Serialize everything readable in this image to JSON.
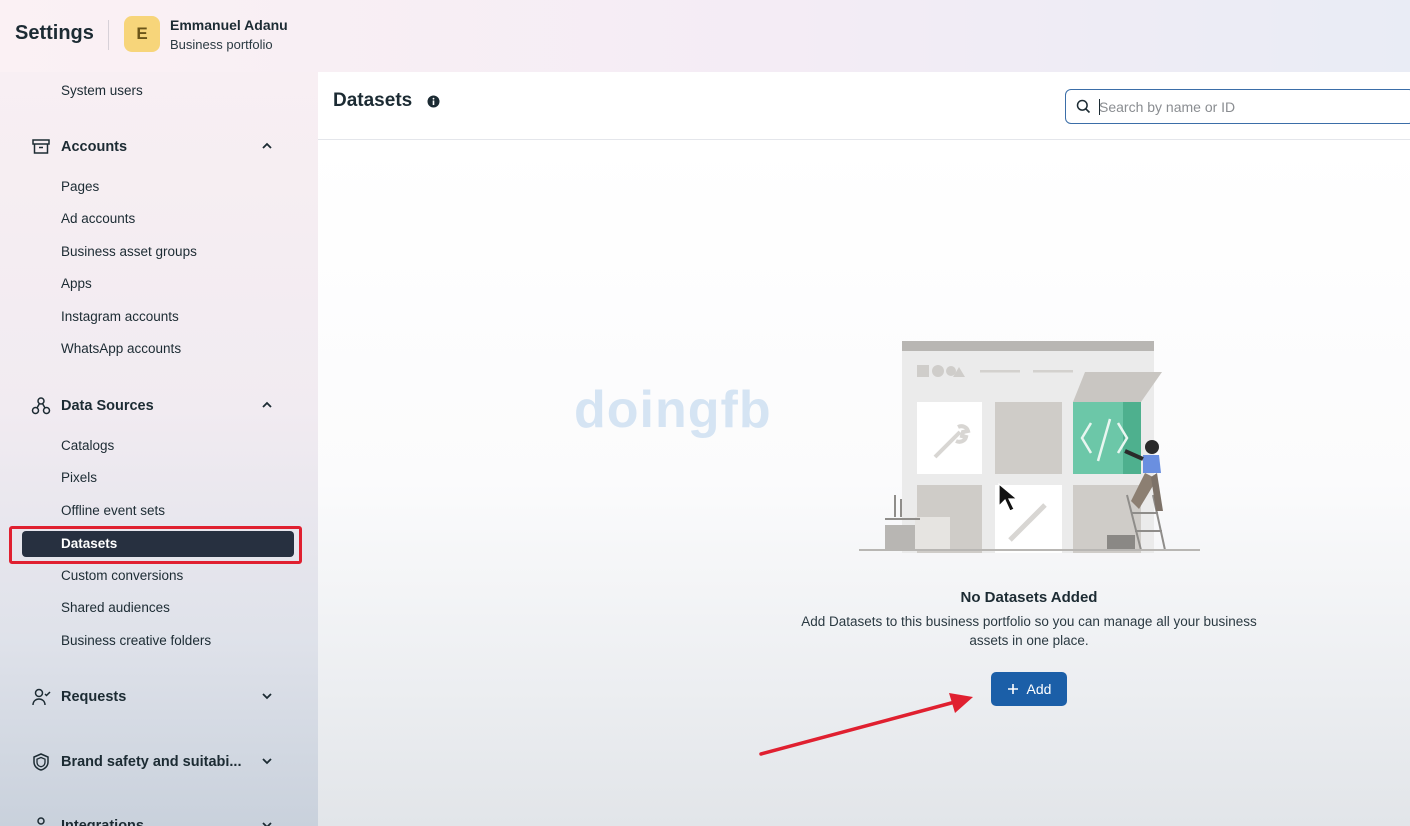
{
  "header": {
    "settings_title": "Settings",
    "avatar_letter": "E",
    "portfolio_name": "Emmanuel Adanu",
    "portfolio_type": "Business portfolio"
  },
  "sidebar": {
    "top_item": "System users",
    "accounts": {
      "label": "Accounts",
      "items": [
        "Pages",
        "Ad accounts",
        "Business asset groups",
        "Apps",
        "Instagram accounts",
        "WhatsApp accounts"
      ]
    },
    "data_sources": {
      "label": "Data Sources",
      "items": [
        "Catalogs",
        "Pixels",
        "Offline event sets",
        "Datasets",
        "Custom conversions",
        "Shared audiences",
        "Business creative folders"
      ]
    },
    "requests": {
      "label": "Requests"
    },
    "brand_safety": {
      "label": "Brand safety and suitabi..."
    },
    "integrations": {
      "label": "Integrations"
    }
  },
  "main": {
    "page_title": "Datasets",
    "search_placeholder": "Search by name or ID",
    "empty_title": "No Datasets Added",
    "empty_description": "Add Datasets to this business portfolio so you can manage all your business assets in one place.",
    "add_button": "Add"
  },
  "overlay": {
    "watermark": "doingfb"
  },
  "colors": {
    "active_bg": "#273040",
    "primary": "#1b5fa8",
    "annotation": "#e02030",
    "accent_green": "#6cc7a8"
  }
}
